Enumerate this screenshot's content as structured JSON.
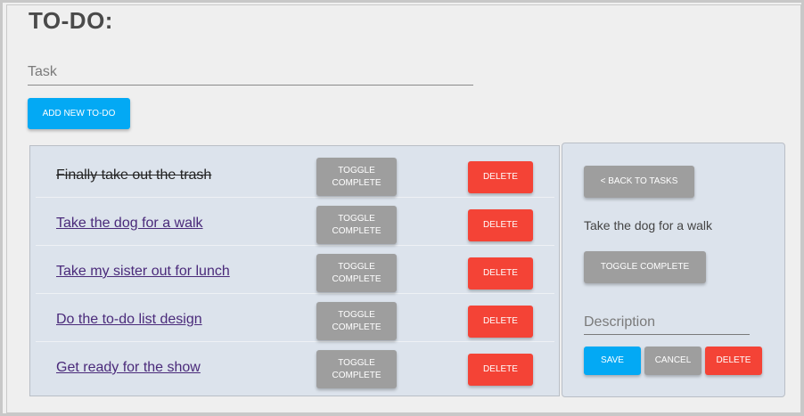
{
  "app": {
    "title": "TO-DO:"
  },
  "new_task": {
    "placeholder": "Task",
    "add_label": "ADD NEW TO-DO"
  },
  "todos": [
    {
      "text": "Finally take out the trash",
      "completed": true,
      "toggle_label": "TOGGLE COMPLETE",
      "delete_label": "DELETE"
    },
    {
      "text": "Take the dog for a walk",
      "completed": false,
      "toggle_label": "TOGGLE COMPLETE",
      "delete_label": "DELETE"
    },
    {
      "text": "Take my sister out for lunch",
      "completed": false,
      "toggle_label": "TOGGLE COMPLETE",
      "delete_label": "DELETE"
    },
    {
      "text": "Do the to-do list design",
      "completed": false,
      "toggle_label": "TOGGLE COMPLETE",
      "delete_label": "DELETE"
    },
    {
      "text": "Get ready for the show",
      "completed": false,
      "toggle_label": "TOGGLE COMPLETE",
      "delete_label": "DELETE"
    }
  ],
  "detail": {
    "back_label": "< BACK TO TASKS",
    "task_title": "Take the dog for a walk",
    "toggle_label": "TOGGLE COMPLETE",
    "description_placeholder": "Description",
    "save_label": "SAVE",
    "cancel_label": "CANCEL",
    "delete_label": "DELETE"
  },
  "colors": {
    "primary": "#03a9f4",
    "neutral": "#9e9e9e",
    "danger": "#f44336",
    "panel": "#dce3ec"
  }
}
